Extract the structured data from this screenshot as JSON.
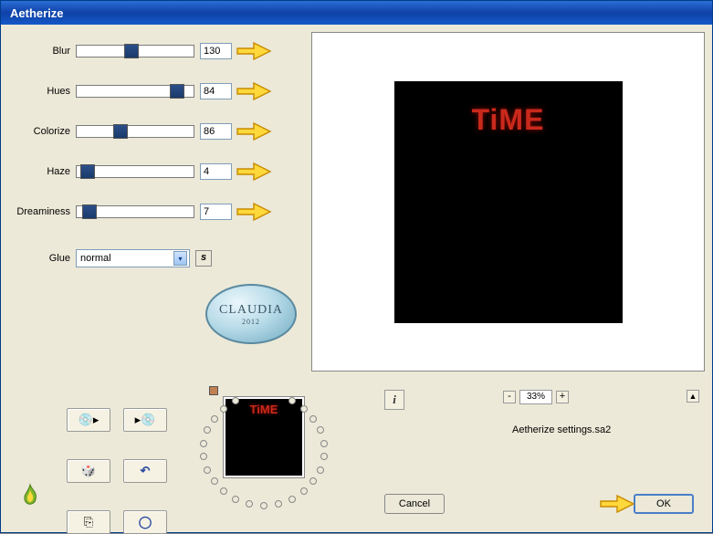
{
  "title": "Aetherize",
  "sliders": [
    {
      "label": "Blur",
      "value": "130",
      "pos": 52
    },
    {
      "label": "Hues",
      "value": "84",
      "pos": 102
    },
    {
      "label": "Colorize",
      "value": "86",
      "pos": 40
    },
    {
      "label": "Haze",
      "value": "4",
      "pos": 4
    },
    {
      "label": "Dreaminess",
      "value": "7",
      "pos": 6
    }
  ],
  "glue": {
    "label": "Glue",
    "value": "normal",
    "s_label": "s"
  },
  "badge": {
    "text": "CLAUDIA",
    "year": "2012"
  },
  "preview_text": "TiME",
  "info_label": "i",
  "zoom": {
    "minus": "-",
    "value": "33%",
    "plus": "+"
  },
  "nav_up": "▲",
  "settings_file": "Aetherize settings.sa2",
  "buttons": {
    "cancel": "Cancel",
    "ok": "OK"
  },
  "icon_btns": {
    "r1a": "💿▶",
    "r1b": "▶💿",
    "r2a": "🎲",
    "r2b": "↶",
    "r3a": "⎘",
    "r3b": "◯"
  }
}
